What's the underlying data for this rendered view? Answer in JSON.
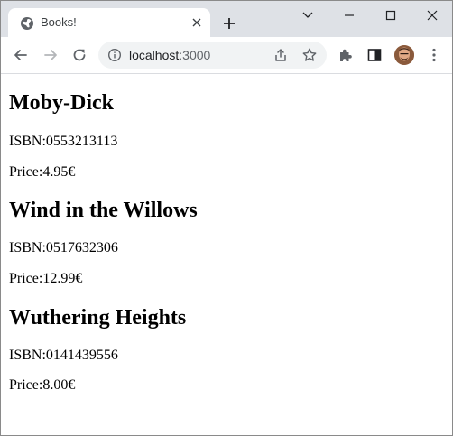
{
  "browser": {
    "tab_title": "Books!",
    "url_host": "localhost",
    "url_port": ":3000"
  },
  "books": [
    {
      "title": "Moby-Dick",
      "isbn_label": "ISBN:",
      "isbn": "0553213113",
      "price_label": "Price:",
      "price": "4.95€"
    },
    {
      "title": "Wind in the Willows",
      "isbn_label": "ISBN:",
      "isbn": "0517632306",
      "price_label": "Price:",
      "price": "12.99€"
    },
    {
      "title": "Wuthering Heights",
      "isbn_label": "ISBN:",
      "isbn": "0141439556",
      "price_label": "Price:",
      "price": "8.00€"
    }
  ],
  "icons": {
    "tab": "globe-icon",
    "tab_close": "close-icon",
    "new_tab": "plus-icon",
    "back": "back-arrow-icon",
    "forward": "forward-arrow-icon",
    "reload": "reload-icon",
    "site_info": "info-icon",
    "share": "share-icon",
    "bookmark": "star-icon",
    "extensions": "puzzle-icon",
    "side_panel": "side-panel-icon",
    "menu": "kebab-menu-icon"
  },
  "colors": {
    "tabbar_bg": "#dee1e6",
    "omnibox_bg": "#f1f3f4",
    "icon": "#5f6368"
  }
}
